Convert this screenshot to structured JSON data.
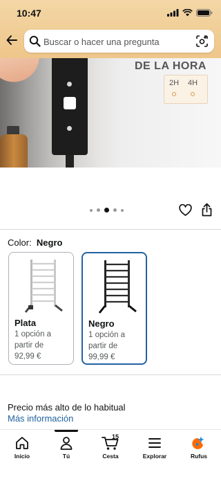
{
  "status_bar": {
    "time": "10:47"
  },
  "search": {
    "placeholder": "Buscar o hacer una pregunta"
  },
  "hero": {
    "title": "DE LA HORA",
    "timer_a": "2H",
    "timer_b": "4H"
  },
  "colors": {
    "accent": "#2162a1",
    "header": "#efc68a",
    "rufus": "#ff6a00"
  },
  "carousel": {
    "total": 5,
    "active": 3
  },
  "color_selector": {
    "label": "Color:",
    "value": "Negro",
    "options": [
      {
        "name": "Plata",
        "line1": "1 opción a",
        "line2": "partir de",
        "price": "92,99 €",
        "selected": false
      },
      {
        "name": "Negro",
        "line1": "1 opción a",
        "line2": "partir de",
        "price": "99,99 €",
        "selected": true
      }
    ]
  },
  "price_note": {
    "text": "Precio más alto de lo habitual",
    "link": "Más información"
  },
  "tab_bar": {
    "items": [
      {
        "label": "Inicio",
        "icon": "home-icon"
      },
      {
        "label": "Tú",
        "icon": "profile-icon"
      },
      {
        "label": "Cesta",
        "icon": "cart-icon"
      },
      {
        "label": "Explorar",
        "icon": "menu-icon"
      },
      {
        "label": "Rufus",
        "icon": "rufus-icon"
      }
    ],
    "cart_count": "15"
  }
}
